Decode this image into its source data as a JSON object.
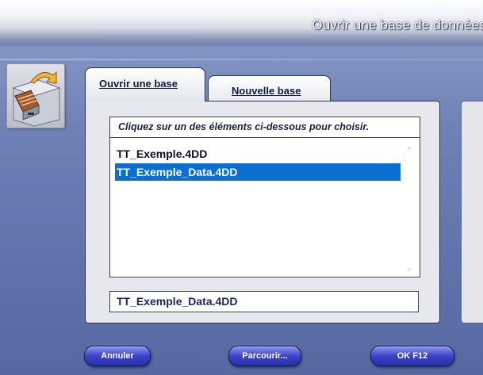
{
  "window": {
    "title": "Ouvrir une base de données"
  },
  "tabs": [
    {
      "label": "Ouvrir une base",
      "active": true
    },
    {
      "label": "Nouvelle base",
      "active": false
    }
  ],
  "list": {
    "header": "Cliquez sur un des éléments ci-dessous pour choisir.",
    "items": [
      "TT_Exemple.4DD",
      "TT_Exemple_Data.4DD"
    ],
    "selected": "TT_Exemple_Data.4DD"
  },
  "selected_field": {
    "value": "TT_Exemple_Data.4DD"
  },
  "buttons": {
    "cancel": "Annuler",
    "browse": "Parcourir...",
    "ok": "OK  F12"
  },
  "icons": {
    "drawer": "file-drawer-icon",
    "scroll_up": "scroll-up-arrow-icon",
    "scroll_down": "scroll-down-arrow-icon"
  },
  "colors": {
    "background": "#6e80b6",
    "selection": "#0a6fcf",
    "button": "#3b43c6"
  }
}
